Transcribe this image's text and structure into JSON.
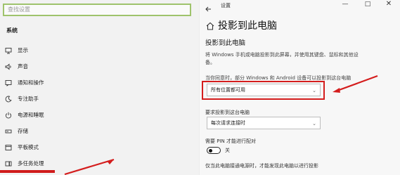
{
  "left": {
    "search_placeholder": "查找设置",
    "section_title": "系统",
    "items": [
      {
        "label": "显示",
        "icon": "display-icon"
      },
      {
        "label": "声音",
        "icon": "sound-icon"
      },
      {
        "label": "通知和操作",
        "icon": "notifications-icon"
      },
      {
        "label": "专注助手",
        "icon": "focus-assist-icon"
      },
      {
        "label": "电源和睡眠",
        "icon": "power-icon"
      },
      {
        "label": "存储",
        "icon": "storage-icon"
      },
      {
        "label": "平板模式",
        "icon": "tablet-mode-icon"
      },
      {
        "label": "多任务处理",
        "icon": "multitasking-icon"
      }
    ]
  },
  "right": {
    "window_title": "设置",
    "window_controls": {
      "minimize": "—",
      "maximize": "□",
      "close": "✕"
    },
    "page_title": "投影到此电脑",
    "sub_title": "投影到此电脑",
    "description": "将 Windows 手机或电脑投影到此屏幕，并使用其键盘、鼠标和其他设备。",
    "q1_label": "当你同意时，部分 Windows 和 Android 设备可以投影到这台电脑",
    "q1_value": "所有位置都可用",
    "q2_label": "要求投影到这台电脑",
    "q2_value": "每次请求连接时",
    "pin_label": "需要 PIN 才能进行配对",
    "toggle_state": "关",
    "last_label": "仅当此电脑接通电源时，才能发现此电脑以进行投影"
  },
  "colors": {
    "highlight": "#d41d1d",
    "search_border": "#9fc36c"
  }
}
